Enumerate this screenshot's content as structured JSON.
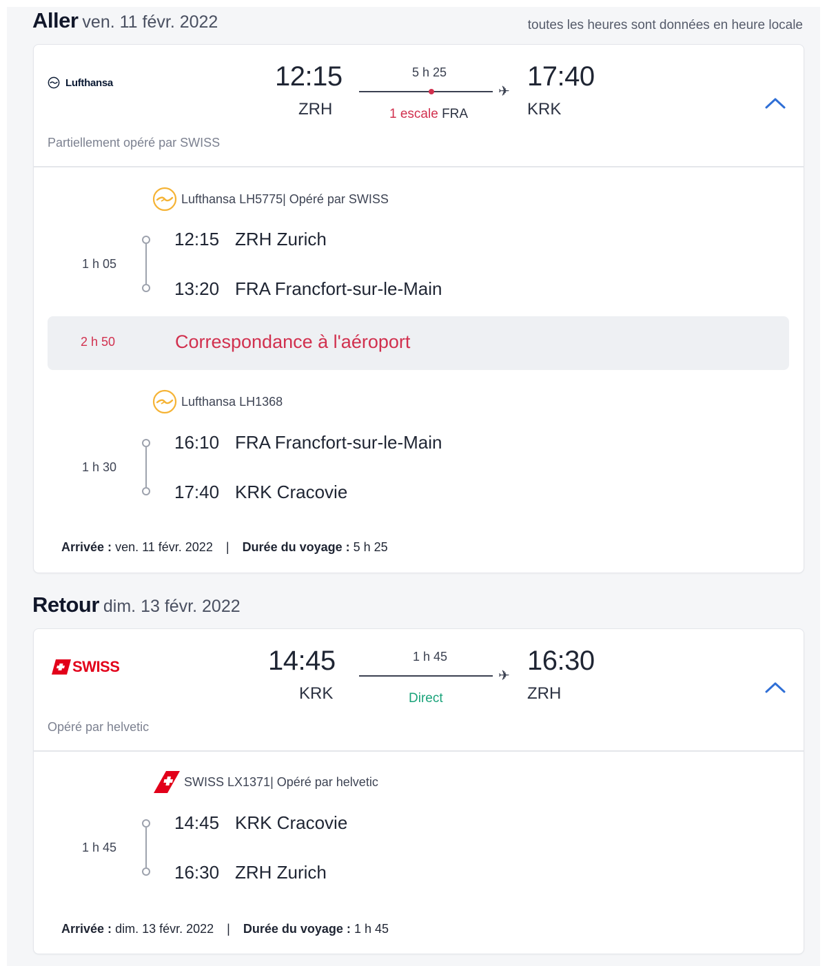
{
  "timezone_note": "toutes les heures sont données en heure locale",
  "outbound": {
    "title": "Aller",
    "date": "ven. 11 févr. 2022",
    "airline": "Lufthansa",
    "dep_time": "12:15",
    "dep_code": "ZRH",
    "arr_time": "17:40",
    "arr_code": "KRK",
    "duration": "5 h 25",
    "stops_label": "1 escale",
    "stop_code": "FRA",
    "operated_note": "Partiellement opéré par SWISS",
    "segments": [
      {
        "header": "Lufthansa LH5775| Opéré par SWISS",
        "duration": "1 h 05",
        "dep_time": "12:15",
        "dep_place": "ZRH Zurich",
        "arr_time": "13:20",
        "arr_place": "FRA Francfort-sur-le-Main"
      },
      {
        "header": "Lufthansa LH1368",
        "duration": "1 h 30",
        "dep_time": "16:10",
        "dep_place": "FRA Francfort-sur-le-Main",
        "arr_time": "17:40",
        "arr_place": "KRK Cracovie"
      }
    ],
    "connection": {
      "duration": "2 h 50",
      "label": "Correspondance à l'aéroport"
    },
    "footer": {
      "arrival_label": "Arrivée :",
      "arrival_value": "ven. 11 févr. 2022",
      "separator": "|",
      "trip_label": "Durée du voyage :",
      "trip_value": "5 h 25"
    }
  },
  "return": {
    "title": "Retour",
    "date": "dim. 13 févr. 2022",
    "airline": "SWISS",
    "dep_time": "14:45",
    "dep_code": "KRK",
    "arr_time": "16:30",
    "arr_code": "ZRH",
    "duration": "1 h 45",
    "stops_label": "Direct",
    "operated_note": "Opéré par helvetic",
    "segments": [
      {
        "header": "SWISS LX1371| Opéré par helvetic",
        "duration": "1 h 45",
        "dep_time": "14:45",
        "dep_place": "KRK Cracovie",
        "arr_time": "16:30",
        "arr_place": "ZRH Zurich"
      }
    ],
    "footer": {
      "arrival_label": "Arrivée :",
      "arrival_value": "dim. 13 févr. 2022",
      "separator": "|",
      "trip_label": "Durée du voyage :",
      "trip_value": "1 h 45"
    }
  },
  "colors": {
    "accent_red": "#d1304e",
    "direct_green": "#1aa37a",
    "chevron_blue": "#2f6fd6",
    "lufthansa_yellow": "#f5b335",
    "swiss_red": "#e2001a"
  },
  "icons": [
    "lufthansa-crane-icon",
    "swiss-flag-icon",
    "plane-icon",
    "chevron-up-icon"
  ]
}
